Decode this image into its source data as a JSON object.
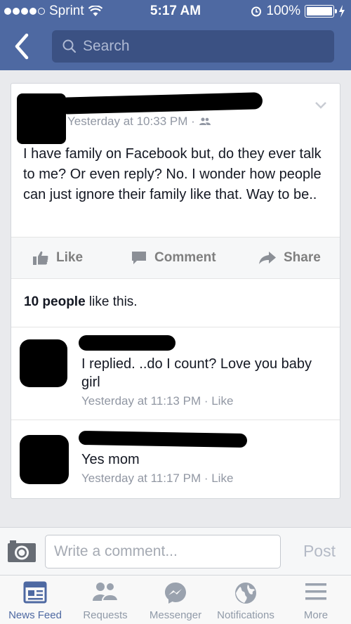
{
  "status_bar": {
    "carrier": "Sprint",
    "time": "5:17 AM",
    "battery": "100%"
  },
  "nav": {
    "search_placeholder": "Search"
  },
  "post": {
    "timestamp": "Yesterday at 10:33 PM ·",
    "text": "I have family on Facebook but, do they ever talk to me? Or even reply? No. I wonder how people can just ignore their family like that. Way to be..",
    "actions": {
      "like": "Like",
      "comment": "Comment",
      "share": "Share"
    },
    "likes_count": "10 people",
    "likes_suffix": " like this."
  },
  "comments": [
    {
      "text": "I replied. ..do I count?  Love you baby girl",
      "time": "Yesterday at 11:13 PM",
      "like": "Like"
    },
    {
      "text": "Yes mom",
      "time": "Yesterday at 11:17 PM",
      "like": "Like"
    }
  ],
  "comment_bar": {
    "placeholder": "Write a comment...",
    "post_label": "Post"
  },
  "tabs": [
    {
      "label": "News Feed",
      "icon": "news-feed-icon",
      "active": true
    },
    {
      "label": "Requests",
      "icon": "requests-icon",
      "active": false
    },
    {
      "label": "Messenger",
      "icon": "messenger-icon",
      "active": false
    },
    {
      "label": "Notifications",
      "icon": "globe-icon",
      "active": false
    },
    {
      "label": "More",
      "icon": "menu-icon",
      "active": false
    }
  ],
  "colors": {
    "brand_blue": "#4e69a2",
    "search_bg": "#3b5183",
    "muted_text": "#9197a3"
  }
}
